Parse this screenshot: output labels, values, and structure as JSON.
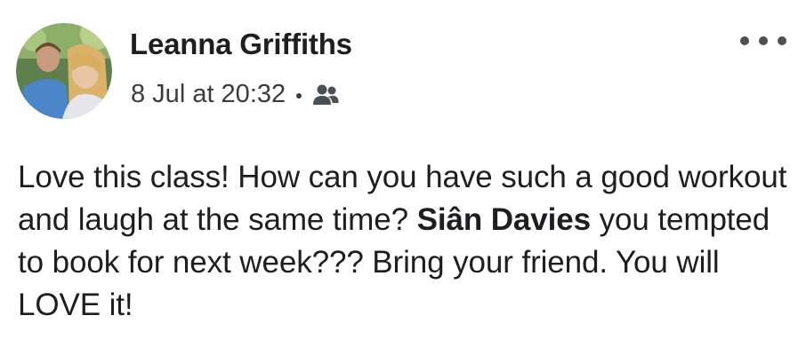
{
  "post": {
    "author_name": "Leanna Griffiths",
    "timestamp": "8 Jul at 20:32",
    "audience_icon": "friends-icon",
    "more_icon": "more-options-icon",
    "text_part1": "Love this class! How can you have such a good workout and laugh at the same time? ",
    "mention": "Siân Davies",
    "text_part2": " you tempted to book for next week??? Bring your friend. You will LOVE it!"
  }
}
